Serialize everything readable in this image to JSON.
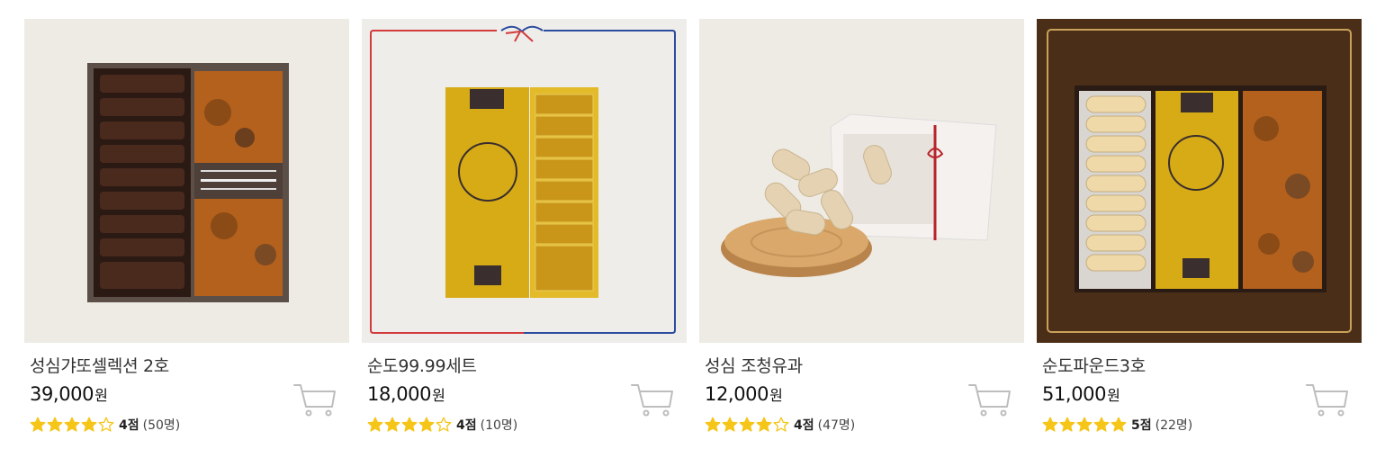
{
  "colors": {
    "star": "#F5C518",
    "cart": "#BDBDBD"
  },
  "icons": {
    "cart": "shopping-cart-icon",
    "star_full": "star-filled-icon",
    "star_empty": "star-outline-icon"
  },
  "products": [
    {
      "name": "성심갸또셀렉션 2호",
      "price": "39,000",
      "currency": "원",
      "stars": 4,
      "score": "4점",
      "reviews": "(50명)"
    },
    {
      "name": "순도99.99세트",
      "price": "18,000",
      "currency": "원",
      "stars": 4,
      "score": "4점",
      "reviews": "(10명)"
    },
    {
      "name": "성심 조청유과",
      "price": "12,000",
      "currency": "원",
      "stars": 4,
      "score": "4점",
      "reviews": "(47명)"
    },
    {
      "name": "순도파운드3호",
      "price": "51,000",
      "currency": "원",
      "stars": 5,
      "score": "5점",
      "reviews": "(22명)"
    }
  ]
}
